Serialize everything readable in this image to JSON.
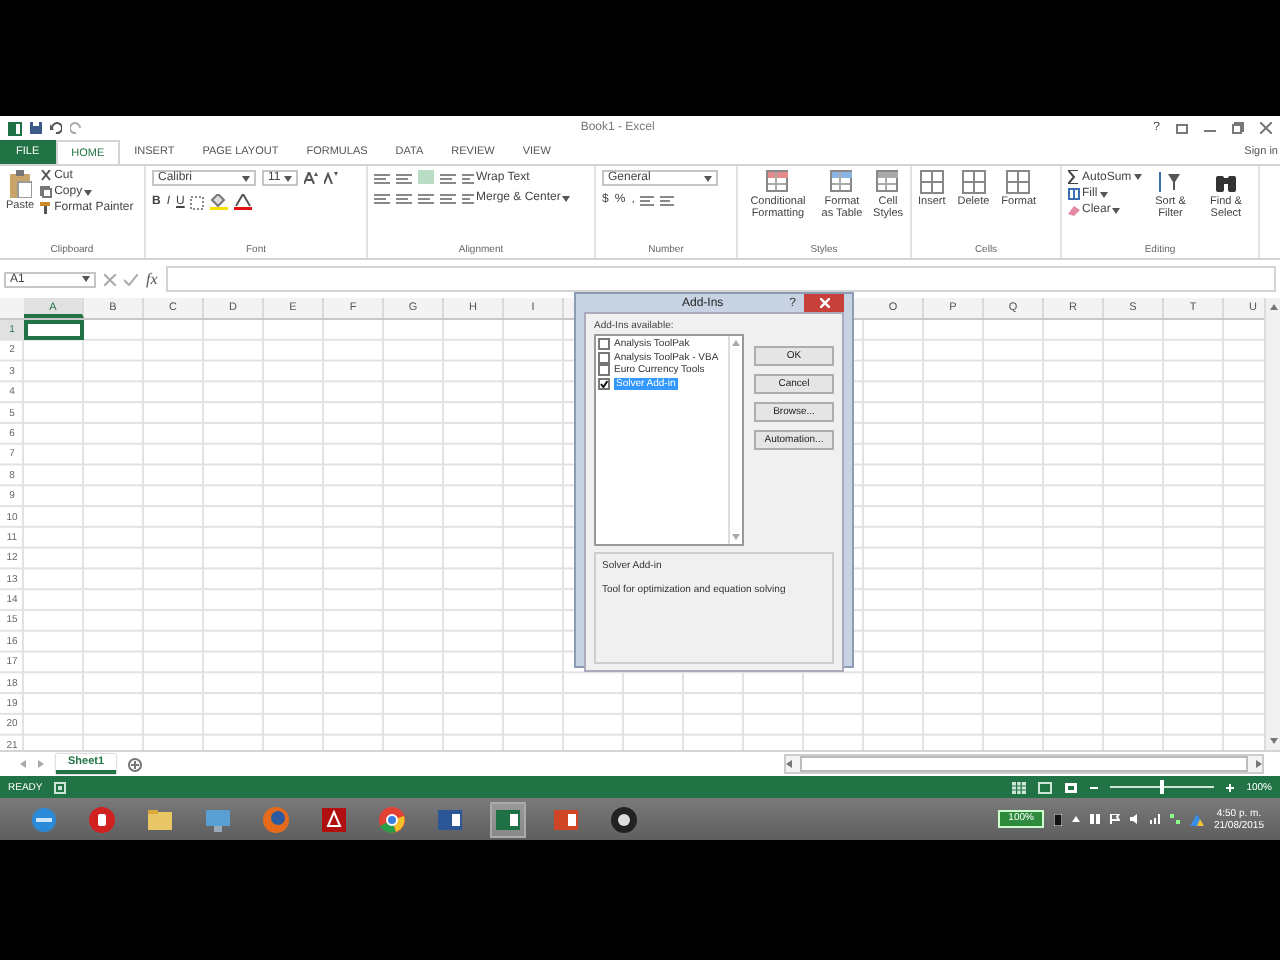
{
  "title_bar": {
    "title": "Book1 - Excel",
    "help": "?"
  },
  "ribbon_tabs": [
    {
      "label": "FILE",
      "kind": "file",
      "selected": false
    },
    {
      "label": "HOME",
      "kind": "tab",
      "selected": true
    },
    {
      "label": "INSERT",
      "kind": "tab",
      "selected": false
    },
    {
      "label": "PAGE LAYOUT",
      "kind": "tab",
      "selected": false
    },
    {
      "label": "FORMULAS",
      "kind": "tab",
      "selected": false
    },
    {
      "label": "DATA",
      "kind": "tab",
      "selected": false
    },
    {
      "label": "REVIEW",
      "kind": "tab",
      "selected": false
    },
    {
      "label": "VIEW",
      "kind": "tab",
      "selected": false
    }
  ],
  "sign_in": "Sign in",
  "ribbon": {
    "clipboard": {
      "paste": "Paste",
      "cut": "Cut",
      "copy": "Copy",
      "format_painter": "Format Painter",
      "label": "Clipboard"
    },
    "font": {
      "font_name": "Calibri",
      "font_size": "11",
      "bold": "B",
      "italic": "I",
      "underline": "U",
      "label": "Font"
    },
    "alignment": {
      "wrap_text": "Wrap Text",
      "merge": "Merge & Center",
      "label": "Alignment"
    },
    "number": {
      "format": "General",
      "currency": "$",
      "percent": "%",
      "comma": ",",
      "label": "Number"
    },
    "styles": {
      "buttons": [
        "Conditional Formatting",
        "Format as Table",
        "Cell Styles"
      ],
      "label": "Styles"
    },
    "cells": {
      "buttons": [
        "Insert",
        "Delete",
        "Format"
      ],
      "label": "Cells"
    },
    "editing": {
      "autosum": "AutoSum",
      "fill": "Fill",
      "clear": "Clear",
      "sort": "Sort & Filter",
      "find": "Find & Select",
      "label": "Editing"
    }
  },
  "formula_bar": {
    "name_box": "A1",
    "function_button": "fx"
  },
  "columns": [
    {
      "label": "A",
      "selected": true
    },
    {
      "label": "B",
      "selected": false
    },
    {
      "label": "C",
      "selected": false
    },
    {
      "label": "D",
      "selected": false
    },
    {
      "label": "E",
      "selected": false
    },
    {
      "label": "F",
      "selected": false
    },
    {
      "label": "G",
      "selected": false
    },
    {
      "label": "H",
      "selected": false
    },
    {
      "label": "I",
      "selected": false
    }
  ],
  "columns_after_dialog": [
    {
      "label": "O",
      "selected": false
    },
    {
      "label": "P",
      "selected": false
    },
    {
      "label": "Q",
      "selected": false
    },
    {
      "label": "R",
      "selected": false
    },
    {
      "label": "S",
      "selected": false
    },
    {
      "label": "T",
      "selected": false
    },
    {
      "label": "U",
      "selected": false
    }
  ],
  "rows": [
    {
      "label": "1",
      "selected": true
    },
    {
      "label": "2",
      "selected": false
    },
    {
      "label": "3",
      "selected": false
    },
    {
      "label": "4",
      "selected": false
    },
    {
      "label": "5",
      "selected": false
    },
    {
      "label": "6",
      "selected": false
    },
    {
      "label": "7",
      "selected": false
    },
    {
      "label": "8",
      "selected": false
    },
    {
      "label": "9",
      "selected": false
    },
    {
      "label": "10",
      "selected": false
    },
    {
      "label": "11",
      "selected": false
    },
    {
      "label": "12",
      "selected": false
    },
    {
      "label": "13",
      "selected": false
    },
    {
      "label": "14",
      "selected": false
    },
    {
      "label": "15",
      "selected": false
    },
    {
      "label": "16",
      "selected": false
    },
    {
      "label": "17",
      "selected": false
    },
    {
      "label": "18",
      "selected": false
    },
    {
      "label": "19",
      "selected": false
    },
    {
      "label": "20",
      "selected": false
    },
    {
      "label": "21",
      "selected": false
    }
  ],
  "sheet_tabs": [
    {
      "label": "Sheet1",
      "selected": true
    }
  ],
  "status_bar": {
    "status": "READY",
    "zoom": "100%",
    "zoom_level": {
      "level": 0.5
    }
  },
  "dialog": {
    "title": "Add-Ins",
    "help": "?",
    "list_label": "Add-Ins available:",
    "items": [
      {
        "label": "Analysis ToolPak",
        "checked": false,
        "selected": false
      },
      {
        "label": "Analysis ToolPak - VBA",
        "checked": false,
        "selected": false
      },
      {
        "label": "Euro Currency Tools",
        "checked": false,
        "selected": false
      },
      {
        "label": "Solver Add-in",
        "checked": true,
        "selected": true
      }
    ],
    "buttons": [
      "OK",
      "Cancel",
      "Browse...",
      "Automation..."
    ],
    "description_title": "Solver Add-in",
    "description": "Tool for optimization and equation solving"
  },
  "taskbar": {
    "apps": [
      {
        "kind": "ie",
        "active": false
      },
      {
        "kind": "media",
        "active": false
      },
      {
        "kind": "folder",
        "active": false
      },
      {
        "kind": "remote",
        "active": false
      },
      {
        "kind": "firefox",
        "active": false
      },
      {
        "kind": "acrobat",
        "active": false
      },
      {
        "kind": "chrome",
        "active": false
      },
      {
        "kind": "word",
        "active": false
      },
      {
        "kind": "excel",
        "active": true
      },
      {
        "kind": "powerpoint",
        "active": false
      },
      {
        "kind": "obs",
        "active": false
      }
    ],
    "battery": "100%",
    "time": "4:50 p. m.",
    "date": "21/08/2015"
  }
}
